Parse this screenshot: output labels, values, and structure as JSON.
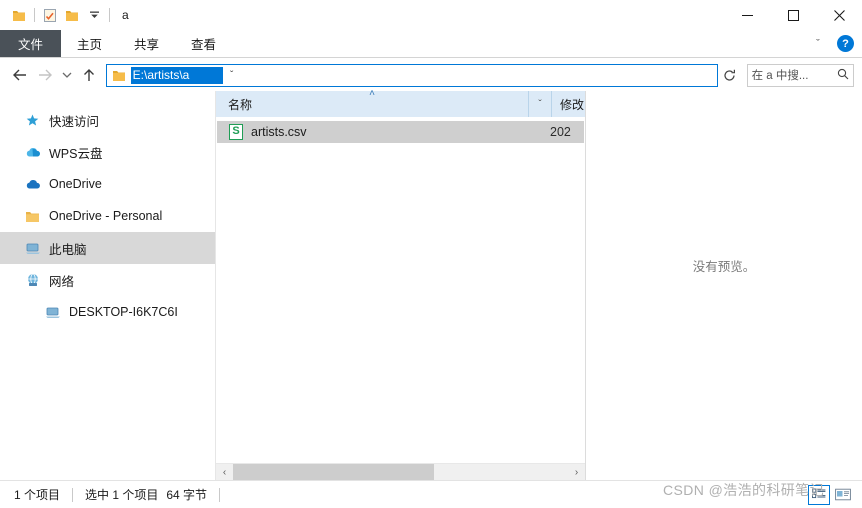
{
  "window": {
    "title": "a",
    "quick_access": [
      {
        "name": "folder-icon",
        "label": "文件夹"
      },
      {
        "name": "properties-icon",
        "label": "属性"
      },
      {
        "name": "new-folder-icon",
        "label": "新建文件夹"
      },
      {
        "name": "customize-chevron-icon",
        "label": "自定义快速访问工具栏"
      }
    ],
    "controls": {
      "minimize": "—",
      "maximize": "☐",
      "close": "✕"
    }
  },
  "ribbon": {
    "tabs": [
      {
        "label": "文件",
        "active": true
      },
      {
        "label": "主页",
        "active": false
      },
      {
        "label": "共享",
        "active": false
      },
      {
        "label": "查看",
        "active": false
      }
    ],
    "collapse_icon": "ˇ",
    "help_label": "?"
  },
  "navbar": {
    "back_label": "←",
    "forward_label": "→",
    "recent_label": "ˇ",
    "up_label": "↑",
    "address": {
      "value": "E:\\artists\\a",
      "chevron": "ˇ"
    },
    "refresh_label": "↻",
    "search": {
      "placeholder": "在 a 中搜...",
      "icon": "⚲"
    }
  },
  "sidebar": {
    "items": [
      {
        "label": "快速访问",
        "icon": "pin-star-icon",
        "selected": false,
        "indent": false
      },
      {
        "label": "WPS云盘",
        "icon": "wps-cloud-icon",
        "selected": false,
        "indent": false
      },
      {
        "label": "OneDrive",
        "icon": "onedrive-cloud-icon",
        "selected": false,
        "indent": false
      },
      {
        "label": "OneDrive - Personal",
        "icon": "folder-icon",
        "selected": false,
        "indent": false
      },
      {
        "label": "此电脑",
        "icon": "this-pc-icon",
        "selected": true,
        "indent": false
      },
      {
        "label": "网络",
        "icon": "network-icon",
        "selected": false,
        "indent": false
      },
      {
        "label": "DESKTOP-I6K7C6I",
        "icon": "computer-icon",
        "selected": false,
        "indent": true
      }
    ]
  },
  "filepane": {
    "columns": [
      {
        "label": "名称",
        "sorted": "asc",
        "sort_arrow": "˄"
      },
      {
        "label": "修改",
        "sorted": "",
        "sort_arrow": ""
      }
    ],
    "column_dropdown_icon": "ˇ",
    "rows": [
      {
        "name": "artists.csv",
        "icon": "spreadsheet-icon",
        "icon_letter": "S",
        "modified": "202",
        "selected": true
      }
    ],
    "scrollbar": {
      "left_arrow": "‹",
      "right_arrow": "›",
      "thumb_percent": 60
    }
  },
  "preview": {
    "message": "没有预览。"
  },
  "statusbar": {
    "item_count": "1 个项目",
    "selection_count": "选中 1 个项目",
    "selection_size": "64 字节",
    "view_buttons": [
      {
        "name": "details-view-button",
        "active": true
      },
      {
        "name": "large-icons-view-button",
        "active": false
      }
    ]
  },
  "watermark": {
    "text": "CSDN @浩浩的科研笔记"
  },
  "colors": {
    "accent": "#0078d7",
    "file_tab": "#4a5158",
    "header": "#dceaf7",
    "selection": "#cfcfcf",
    "sidebar_selection": "#d8d8d8",
    "csv_green": "#1f9d55"
  }
}
